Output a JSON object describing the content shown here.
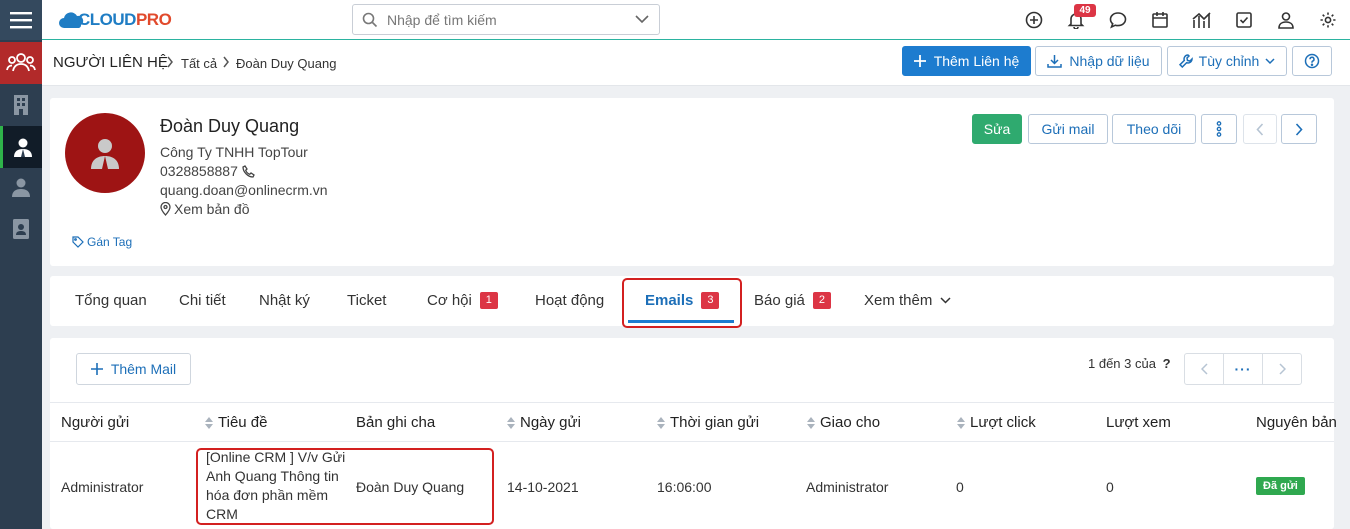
{
  "app": {
    "logo_text_a": "CLOUD",
    "logo_text_b": "PRO"
  },
  "search": {
    "placeholder": "Nhập để tìm kiếm"
  },
  "notifications": {
    "count": "49"
  },
  "breadcrumb": {
    "module": "NGƯỜI LIÊN HỆ",
    "level1": "Tất cả",
    "level2": "Đoàn Duy Quang"
  },
  "header_buttons": {
    "add_contact": "Thêm Liên hệ",
    "import": "Nhập dữ liệu",
    "customize": "Tùy chỉnh"
  },
  "contact": {
    "name": "Đoàn Duy Quang",
    "company": "Công Ty TNHH TopTour",
    "phone": "0328858887",
    "email": "quang.doan@onlinecrm.vn",
    "map": "Xem bản đồ",
    "tag": "Gán Tag"
  },
  "profile_buttons": {
    "edit": "Sửa",
    "send_mail": "Gửi mail",
    "follow": "Theo dõi"
  },
  "tabs": [
    {
      "label": "Tổng quan"
    },
    {
      "label": "Chi tiết"
    },
    {
      "label": "Nhật ký"
    },
    {
      "label": "Ticket"
    },
    {
      "label": "Cơ hội",
      "count": "1"
    },
    {
      "label": "Hoạt động"
    },
    {
      "label": "Emails",
      "count": "3"
    },
    {
      "label": "Báo giá",
      "count": "2"
    },
    {
      "label": "Xem thêm"
    }
  ],
  "emails": {
    "add_button": "Thêm Mail",
    "pager_text": "1 đến 3 của",
    "pager_help": "?",
    "pager_more": "···",
    "columns": [
      "Người gửi",
      "Tiêu đề",
      "Bản ghi cha",
      "Ngày gửi",
      "Thời gian gửi",
      "Giao cho",
      "Lượt click",
      "Lượt xem",
      "Nguyên bản"
    ],
    "rows": [
      {
        "sender": "Administrator",
        "subject": [
          "[Online CRM ] V/v Gửi",
          "Anh Quang Thông tin",
          "hóa đơn phần mềm",
          "CRM"
        ],
        "parent": "Đoàn Duy Quang",
        "date": "14-10-2021",
        "time": "16:06:00",
        "assigned": "Administrator",
        "clicks": "0",
        "views": "0",
        "status": "Đã gửi"
      }
    ]
  },
  "colors": {
    "primary": "#1d7ccf",
    "danger": "#dc3545",
    "success": "#2faa6f",
    "rail": "#2d3e50"
  }
}
